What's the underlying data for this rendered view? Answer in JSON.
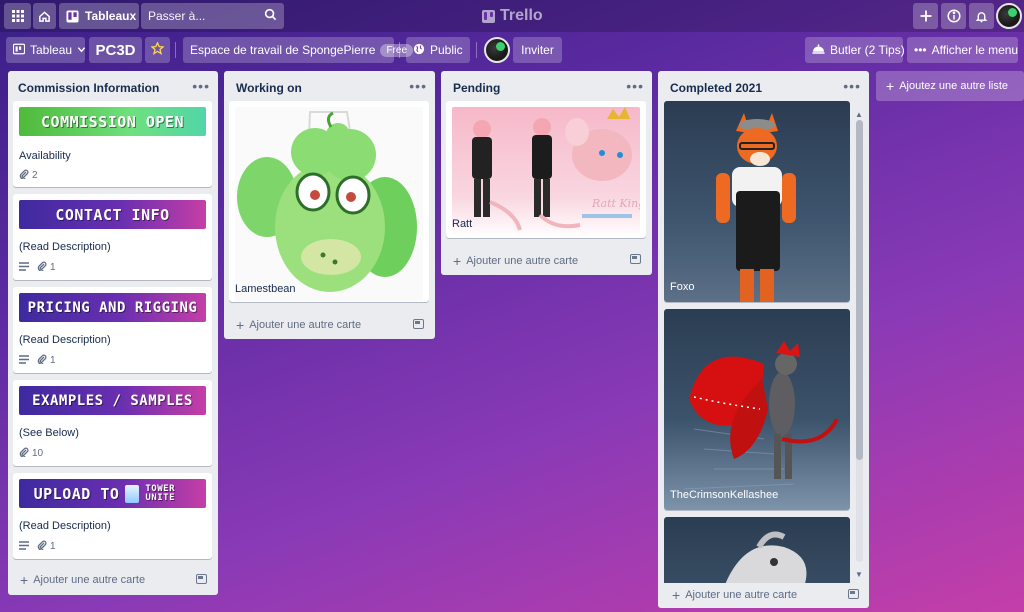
{
  "topnav": {
    "apps_icon": "grid-icon",
    "home_icon": "home-icon",
    "boards_label": "Tableaux",
    "search_placeholder": "Passer à...",
    "logo_text": "Trello",
    "create_icon": "plus-icon",
    "info_icon": "info-icon",
    "notifications_icon": "bell-icon"
  },
  "board_header": {
    "view_label": "Tableau",
    "board_name": "PC3D",
    "workspace_label": "Espace de travail de SpongePierre",
    "workspace_badge": "Free",
    "visibility_label": "Public",
    "invite_label": "Inviter",
    "butler_label": "Butler (2 Tips)",
    "menu_label": "Afficher le menu"
  },
  "lists": [
    {
      "title": "Commission Information",
      "cards": [
        {
          "cover_text": "COMMISSION OPEN",
          "cover_color": "#4fba3a",
          "title": "Availability",
          "attachments": "2",
          "has_description": false
        },
        {
          "cover_text": "CONTACT INFO",
          "cover_color": "#5a2aa8",
          "title": "(Read Description)",
          "attachments": "1",
          "has_description": true
        },
        {
          "cover_text": "PRICING AND RIGGING",
          "cover_color": "#5a2aa8",
          "title": "(Read Description)",
          "attachments": "1",
          "has_description": true
        },
        {
          "cover_text": "EXAMPLES / SAMPLES",
          "cover_color": "#5a2aa8",
          "title": "(See Below)",
          "attachments": "10",
          "has_description": false
        },
        {
          "cover_text": "UPLOAD TO",
          "cover_logo": "TOWER UNITE",
          "cover_color": "#5a2aa8",
          "title": "(Read Description)",
          "attachments": "1",
          "has_description": true
        }
      ],
      "add_card_label": "Ajouter une autre carte"
    },
    {
      "title": "Working on",
      "cards": [
        {
          "title": "Lamestbean"
        }
      ],
      "add_card_label": "Ajouter une autre carte"
    },
    {
      "title": "Pending",
      "cards": [
        {
          "title": "Ratt",
          "art_caption": "Ratt King"
        }
      ],
      "add_card_label": "Ajouter une autre carte"
    },
    {
      "title": "Completed 2021",
      "cards": [
        {
          "title": "Foxo"
        },
        {
          "title": "TheCrimsonKellashee"
        },
        {
          "title": ""
        }
      ],
      "add_card_label": "Ajouter une autre carte"
    }
  ],
  "add_list_label": "Ajoutez une autre liste",
  "colors": {
    "accent_green": "#4fba3a",
    "accent_purple": "#5a2aa8",
    "list_bg": "#ebecf0"
  }
}
